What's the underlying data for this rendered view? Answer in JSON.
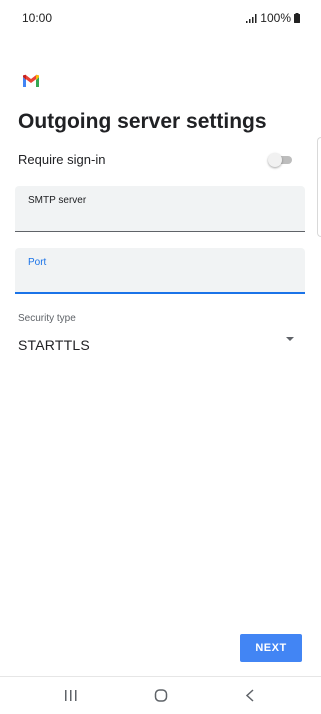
{
  "status_bar": {
    "time": "10:00",
    "battery": "100%",
    "icons": [
      "signal-icon",
      "battery-icon"
    ]
  },
  "app": {
    "logo": "gmail-logo-icon"
  },
  "page": {
    "title": "Outgoing server settings"
  },
  "require_signin": {
    "label": "Require sign-in",
    "enabled": false
  },
  "fields": {
    "smtp_server": {
      "label": "SMTP server",
      "value": ""
    },
    "port": {
      "label": "Port",
      "value": ""
    }
  },
  "security": {
    "label": "Security type",
    "value": "STARTTLS"
  },
  "actions": {
    "next_label": "NEXT"
  },
  "nav_bar": {
    "icons": [
      "recents-icon",
      "home-icon",
      "back-icon"
    ]
  },
  "colors": {
    "accent": "#4285f4",
    "focus": "#1a73e8",
    "field_background": "#f1f3f4"
  }
}
